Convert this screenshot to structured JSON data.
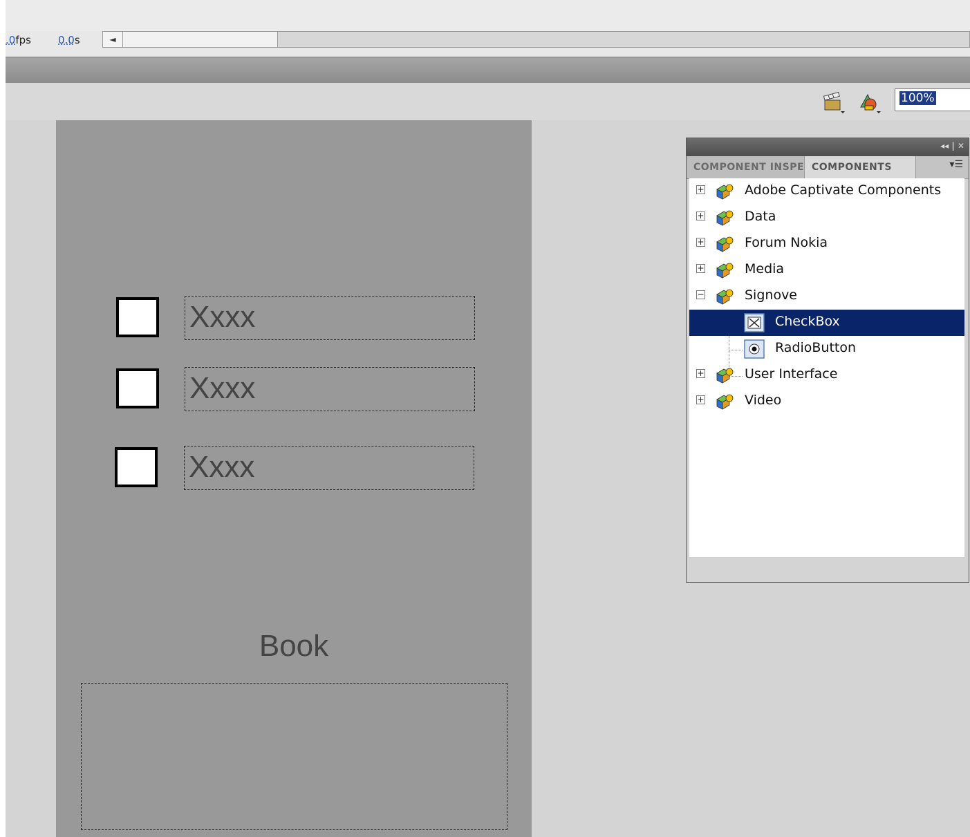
{
  "timeline": {
    "fps_value": ".0",
    "fps_unit": "fps",
    "time_value": "0.0",
    "time_unit": "s",
    "scroll_left_arrow": "◄"
  },
  "toolbar": {
    "edit_scene_icon": "clapperboard-icon",
    "edit_symbols_icon": "shapes-icon",
    "zoom_value": "100%"
  },
  "stage": {
    "checkboxes": [
      {
        "label": "Xxxx"
      },
      {
        "label": "Xxxx"
      },
      {
        "label": "Xxxx"
      }
    ],
    "book_label": "Book"
  },
  "panel": {
    "tab_inactive": "COMPONENT INSPECTOR",
    "tab_active": "COMPONENTS",
    "tree": [
      {
        "label": "Adobe Captivate Components",
        "expanded": false
      },
      {
        "label": "Data",
        "expanded": false
      },
      {
        "label": "Forum Nokia",
        "expanded": false
      },
      {
        "label": "Media",
        "expanded": false
      },
      {
        "label": "Signove",
        "expanded": true
      },
      {
        "label": "CheckBox",
        "child": true,
        "selected": true
      },
      {
        "label": "RadioButton",
        "child": true
      },
      {
        "label": "User Interface",
        "expanded": false
      },
      {
        "label": "Video",
        "expanded": false
      }
    ]
  },
  "colors": {
    "stage_bg": "#999999",
    "selection": "#0a246a"
  }
}
